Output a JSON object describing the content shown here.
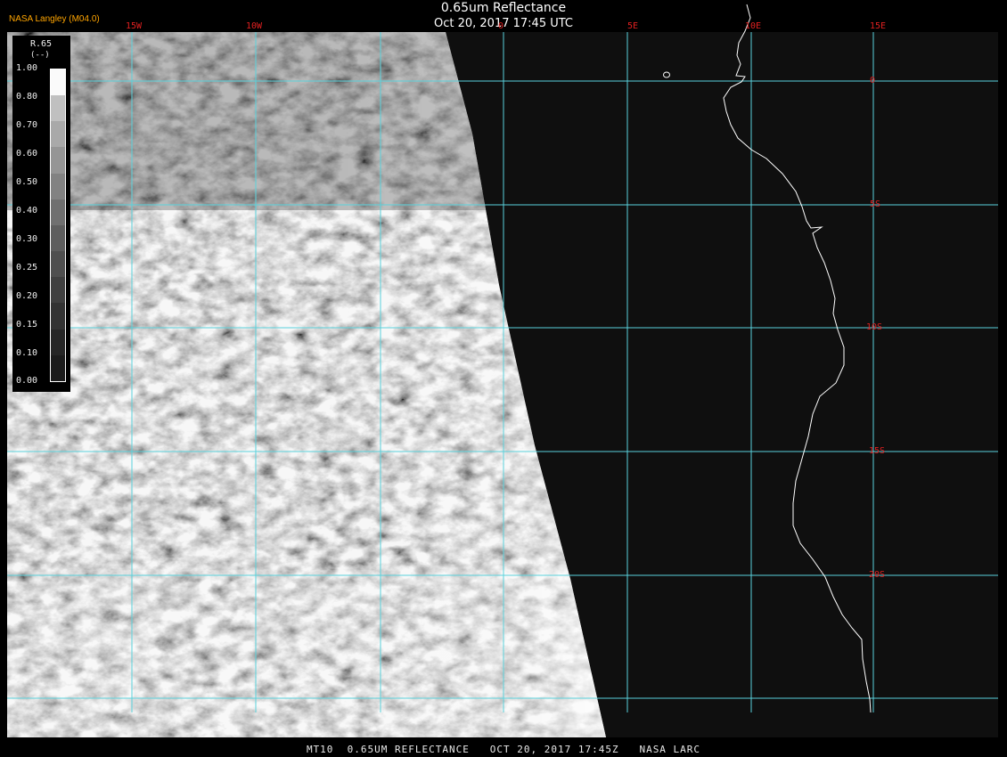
{
  "header": {
    "title": "0.65um Reflectance",
    "datetime": "Oct 20, 2017 17:45 UTC",
    "credit": "NASA Langley (M04.0)"
  },
  "footer": {
    "caption": "MT10  0.65UM REFLECTANCE   OCT 20, 2017 17:45Z   NASA LARC"
  },
  "map": {
    "longitude_labels": [
      "15W",
      "10W",
      "0",
      "5E",
      "10E",
      "15E"
    ],
    "latitude_labels": [
      "0",
      "5S",
      "10S",
      "15S",
      "20S"
    ],
    "grid_color": "#5ad2dc",
    "label_color": "#e02020",
    "coastline_color": "#ffffff"
  },
  "legend": {
    "variable": "R.65",
    "unit": "(--)",
    "ticks": [
      "1.00",
      "0.80",
      "0.70",
      "0.60",
      "0.50",
      "0.40",
      "0.30",
      "0.25",
      "0.20",
      "0.15",
      "0.10",
      "0.00"
    ],
    "colors": [
      "#1c1c1c",
      "#262626",
      "#333333",
      "#404040",
      "#4f4f4f",
      "#5e5e5e",
      "#707070",
      "#828282",
      "#959595",
      "#a9a9a9",
      "#c0c0c0",
      "#fafafa"
    ]
  }
}
